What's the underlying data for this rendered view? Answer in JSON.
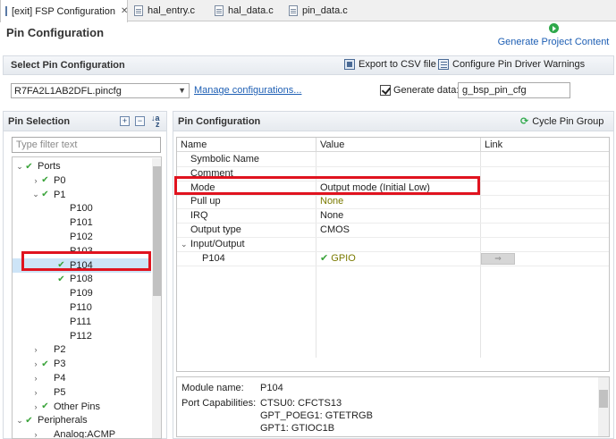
{
  "tabs": [
    {
      "label": "[exit] FSP Configuration",
      "active": true
    },
    {
      "label": "hal_entry.c"
    },
    {
      "label": "hal_data.c"
    },
    {
      "label": "pin_data.c"
    }
  ],
  "page": {
    "title": "Pin Configuration",
    "generate_label": "Generate Project Content"
  },
  "select_section": {
    "title": "Select Pin Configuration",
    "export_label": "Export to CSV file",
    "warnings_label": "Configure Pin Driver Warnings",
    "config_value": "R7FA2L1AB2DFL.pincfg",
    "manage_label": "Manage configurations...",
    "generate_data_label": "Generate data:",
    "generate_data_value": "g_bsp_pin_cfg",
    "generate_data_checked": true
  },
  "pin_selection": {
    "title": "Pin Selection",
    "filter_placeholder": "Type filter text",
    "tree": [
      {
        "label": "Ports",
        "depth": 0,
        "expanded": true,
        "check": true
      },
      {
        "label": "P0",
        "depth": 1,
        "expanded": false,
        "check": true
      },
      {
        "label": "P1",
        "depth": 1,
        "expanded": true,
        "check": true
      },
      {
        "label": "P100",
        "depth": 2
      },
      {
        "label": "P101",
        "depth": 2
      },
      {
        "label": "P102",
        "depth": 2
      },
      {
        "label": "P103",
        "depth": 2
      },
      {
        "label": "P104",
        "depth": 2,
        "check": true,
        "selected": true
      },
      {
        "label": "P108",
        "depth": 2,
        "check": true
      },
      {
        "label": "P109",
        "depth": 2
      },
      {
        "label": "P110",
        "depth": 2
      },
      {
        "label": "P111",
        "depth": 2
      },
      {
        "label": "P112",
        "depth": 2
      },
      {
        "label": "P2",
        "depth": 1,
        "expanded": false
      },
      {
        "label": "P3",
        "depth": 1,
        "expanded": false,
        "check": true
      },
      {
        "label": "P4",
        "depth": 1,
        "expanded": false
      },
      {
        "label": "P5",
        "depth": 1,
        "expanded": false
      },
      {
        "label": "Other Pins",
        "depth": 1,
        "expanded": false,
        "check": true
      },
      {
        "label": "Peripherals",
        "depth": 0,
        "expanded": true,
        "check": true
      },
      {
        "label": "Analog:ACMP",
        "depth": 1,
        "expanded": false
      }
    ]
  },
  "pin_config": {
    "title": "Pin Configuration",
    "cycle_label": "Cycle Pin Group",
    "columns": [
      "Name",
      "Value",
      "Link"
    ],
    "rows": [
      {
        "name": "Symbolic Name",
        "value": ""
      },
      {
        "name": "Comment",
        "value": ""
      },
      {
        "name": "Mode",
        "value": "Output mode (Initial Low)"
      },
      {
        "name": "Pull up",
        "value": "None"
      },
      {
        "name": "IRQ",
        "value": "None"
      },
      {
        "name": "Output type",
        "value": "CMOS"
      },
      {
        "name": "Input/Output",
        "value": "",
        "group": true
      },
      {
        "name": "P104",
        "value": "GPIO",
        "link": "⇒"
      }
    ],
    "module_label": "Module name:",
    "module_value": "P104",
    "capabilities_label": "Port Capabilities:",
    "capabilities": [
      "CTSU0: CFCTS13",
      "GPT_POEG1: GTETRGB",
      "GPT1: GTIOC1B"
    ]
  },
  "colors": {
    "accent_link": "#1e5fb4",
    "check_green": "#3aa33a",
    "highlight_red": "#e0131f",
    "olive_value": "#7a7a00"
  }
}
